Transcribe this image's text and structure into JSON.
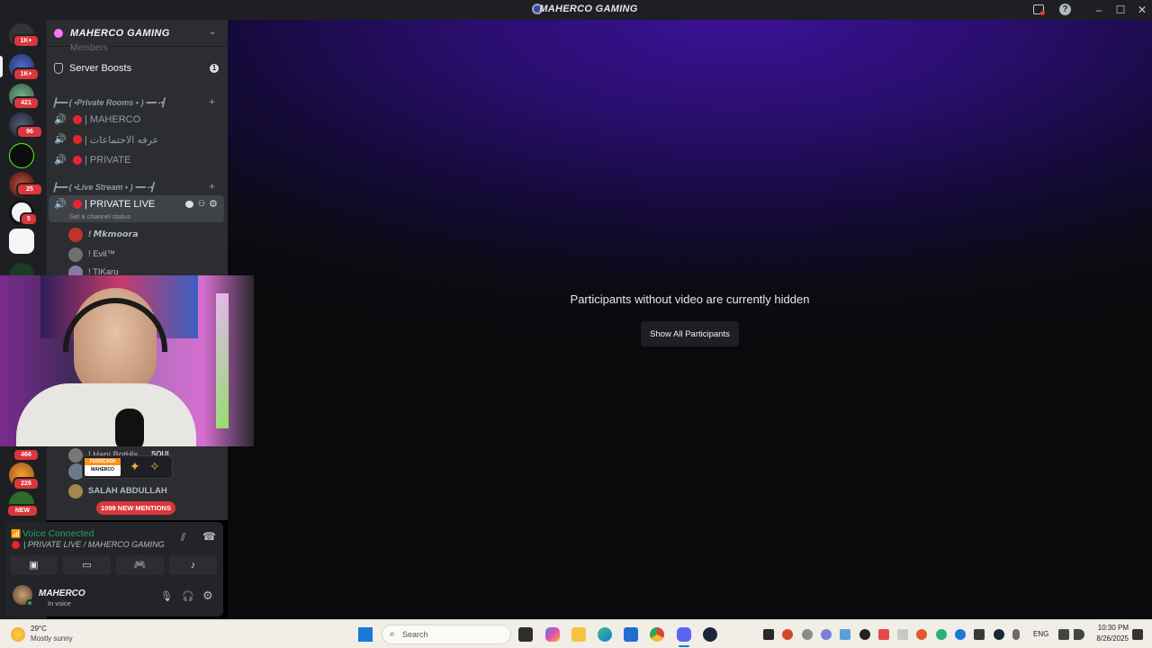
{
  "window": {
    "title": "MAHERCO GAMING"
  },
  "server_rail": {
    "badges": [
      "1K+",
      "1K+",
      "421",
      "96",
      "25",
      "5",
      "466",
      "226",
      "NEW"
    ]
  },
  "server": {
    "name": "MAHERCO GAMING",
    "members_label": "Members",
    "boosts_label": "Server Boosts",
    "boosts_count": "1"
  },
  "categories": [
    {
      "label": "┣━━ ( •Private Rooms • ) ━━ -┫"
    },
    {
      "label": "┣━━ ( •Live Stream • ) ━━ -┫"
    }
  ],
  "channels": [
    {
      "label": "| MAHERCO"
    },
    {
      "label": "| عرفه الاجتماعات"
    },
    {
      "label": "| PRIVATE"
    }
  ],
  "active_channel": {
    "label": "| PRIVATE LIVE",
    "status_placeholder": "Set a channel status"
  },
  "members": [
    {
      "name": "! 𝙈𝙠𝙢𝙤𝙤𝙧𝙖"
    },
    {
      "name": "! Evil™"
    },
    {
      "name": "! TIKaru"
    },
    {
      "name": "! Hani BotHix"
    },
    {
      "name": "SALAH ABDULLAH"
    }
  ],
  "member_tags": {
    "soul": "SOUL",
    "card_brand": "FOODCASH",
    "card_text": "MAHERCO"
  },
  "mentions_pill": "1099 NEW MENTIONS",
  "voice_panel": {
    "status": "Voice Connected",
    "location": "| PRIVATE LIVE / MAHERCO GAMING"
  },
  "user": {
    "name": "MAHERCO",
    "status": "In voice"
  },
  "main": {
    "hidden_message": "Participants without video are currently hidden",
    "show_all_button": "Show All Participants"
  },
  "taskbar": {
    "weather_temp": "29°C",
    "weather_desc": "Mostly sunny",
    "search_placeholder": "Search",
    "language": "ENG",
    "time": "10:30 PM",
    "date": "8/26/2025"
  },
  "colors": {
    "accent_red": "#da373c",
    "voice_green": "#23a55a",
    "live_dot": "#e8252e",
    "main_purple": "#3a1296"
  }
}
